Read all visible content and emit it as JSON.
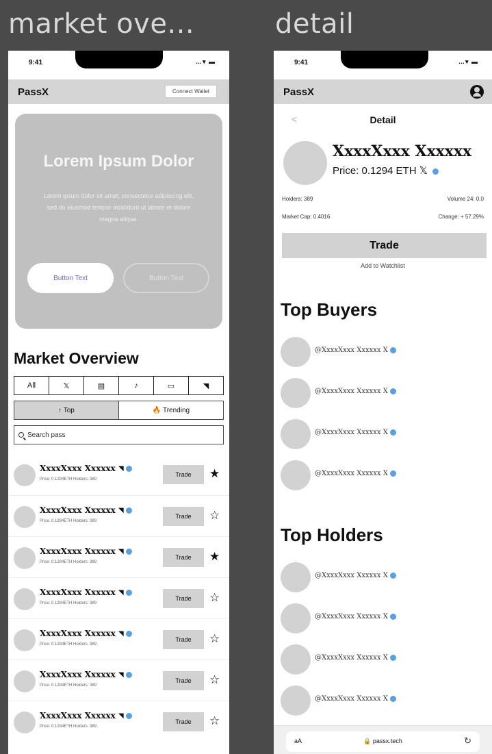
{
  "frames": {
    "left_title": "market ove...",
    "right_title": "detail"
  },
  "statusbar": {
    "time": "9:41",
    "icons": "…▾ ▬"
  },
  "market": {
    "brand": "PassX",
    "connect_label": "Connect Wallet",
    "hero": {
      "title": "Lorem Ipsum Dolor",
      "body": "Lorem ipsum dolor sit amet, consectetur adipiscing elit, sed do eiusmod tempor incididunt ut labore et dolore magna aliqua.",
      "primary_button": "Button Text",
      "secondary_button": "Button Text"
    },
    "section_title": "Market Overview",
    "filters": [
      "All",
      "𝕏",
      "▤",
      "♪",
      "▭",
      "◥"
    ],
    "tabs": {
      "top": "↑ Top",
      "trending": "🔥 Trending"
    },
    "search_placeholder": "Search pass",
    "trade_label": "Trade",
    "items": [
      {
        "name": "XxxxXxxx Xxxxxx",
        "sub": "Price: 0.1294ETH Holders: 389",
        "star": "★"
      },
      {
        "name": "XxxxXxxx Xxxxxx",
        "sub": "Price: 0.1294ETH Holders: 389",
        "star": "☆"
      },
      {
        "name": "XxxxXxxx Xxxxxx",
        "sub": "Price: 0.1294ETH Holders: 389",
        "star": "★"
      },
      {
        "name": "XxxxXxxx Xxxxxx",
        "sub": "Price: 0.1294ETH Holders: 389",
        "star": "☆"
      },
      {
        "name": "XxxxXxxx Xxxxxx",
        "sub": "Price: 0.1294ETH Holders: 389",
        "star": "☆"
      },
      {
        "name": "XxxxXxxx Xxxxxx",
        "sub": "Price: 0.1294ETH Holders: 389",
        "star": "☆"
      },
      {
        "name": "XxxxXxxx Xxxxxx",
        "sub": "Price: 0.1294ETH Holders: 389",
        "star": "☆"
      }
    ]
  },
  "detail": {
    "brand": "PassX",
    "back": "<",
    "title": "Detail",
    "name": "XxxxXxxx Xxxxxx",
    "price": "Price: 0.1294 ETH  𝕏",
    "stats": {
      "holders": "Holders: 389",
      "volume": "Volume 24: 0.0",
      "market_cap": "Market Cap: 0.4016",
      "change": "Change: + 57.29%"
    },
    "trade_label": "Trade",
    "watchlist_label": "Add to Watchlist",
    "top_buyers_title": "Top  Buyers",
    "top_holders_title": "Top Holders",
    "buyers": [
      "@XxxxXxxx Xxxxxx X",
      "@XxxxXxxx Xxxxxx X",
      "@XxxxXxxx Xxxxxx X",
      "@XxxxXxxx Xxxxxx X"
    ],
    "holders": [
      "@XxxxXxxx Xxxxxx X",
      "@XxxxXxxx Xxxxxx X",
      "@XxxxXxxx Xxxxxx X",
      "@XxxxXxxx Xxxxxx X"
    ],
    "browser": {
      "aa": "aA",
      "url": "🔒 passx.tech",
      "reload": "↻"
    }
  },
  "colors": {
    "verified": "#5aa0e0",
    "panel": "#d2d2d2",
    "hero": "#c0c0c0",
    "canvas": "#4a4a4a"
  }
}
